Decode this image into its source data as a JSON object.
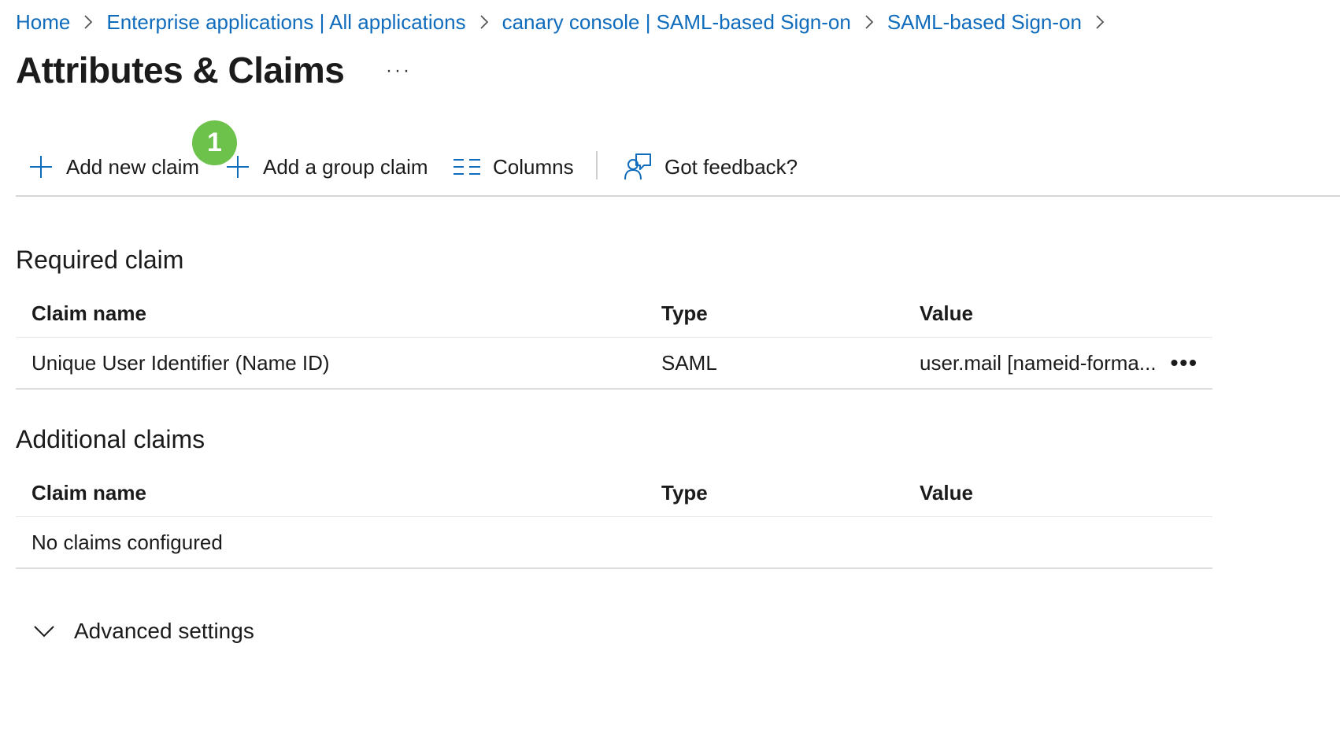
{
  "breadcrumb": [
    {
      "label": "Home"
    },
    {
      "label": "Enterprise applications | All applications"
    },
    {
      "label": "canary console | SAML-based Sign-on"
    },
    {
      "label": "SAML-based Sign-on"
    }
  ],
  "page": {
    "title": "Attributes & Claims",
    "more": "···"
  },
  "toolbar": {
    "add_new_claim": "Add new claim",
    "add_group_claim": "Add a group claim",
    "columns": "Columns",
    "feedback": "Got feedback?",
    "step_badge": "1"
  },
  "required": {
    "title": "Required claim",
    "headers": {
      "name": "Claim name",
      "type": "Type",
      "value": "Value"
    },
    "rows": [
      {
        "name": "Unique User Identifier (Name ID)",
        "type": "SAML",
        "value": "user.mail [nameid-forma...",
        "more": "•••"
      }
    ]
  },
  "additional": {
    "title": "Additional claims",
    "headers": {
      "name": "Claim name",
      "type": "Type",
      "value": "Value"
    },
    "empty": "No claims configured"
  },
  "advanced": {
    "label": "Advanced settings"
  },
  "colors": {
    "link": "#0f6cbd",
    "badge": "#6cc24a",
    "text": "#1b1b1b"
  },
  "icons": [
    "chevron-right-icon",
    "plus-icon",
    "columns-icon",
    "feedback-icon",
    "chevron-down-icon"
  ]
}
